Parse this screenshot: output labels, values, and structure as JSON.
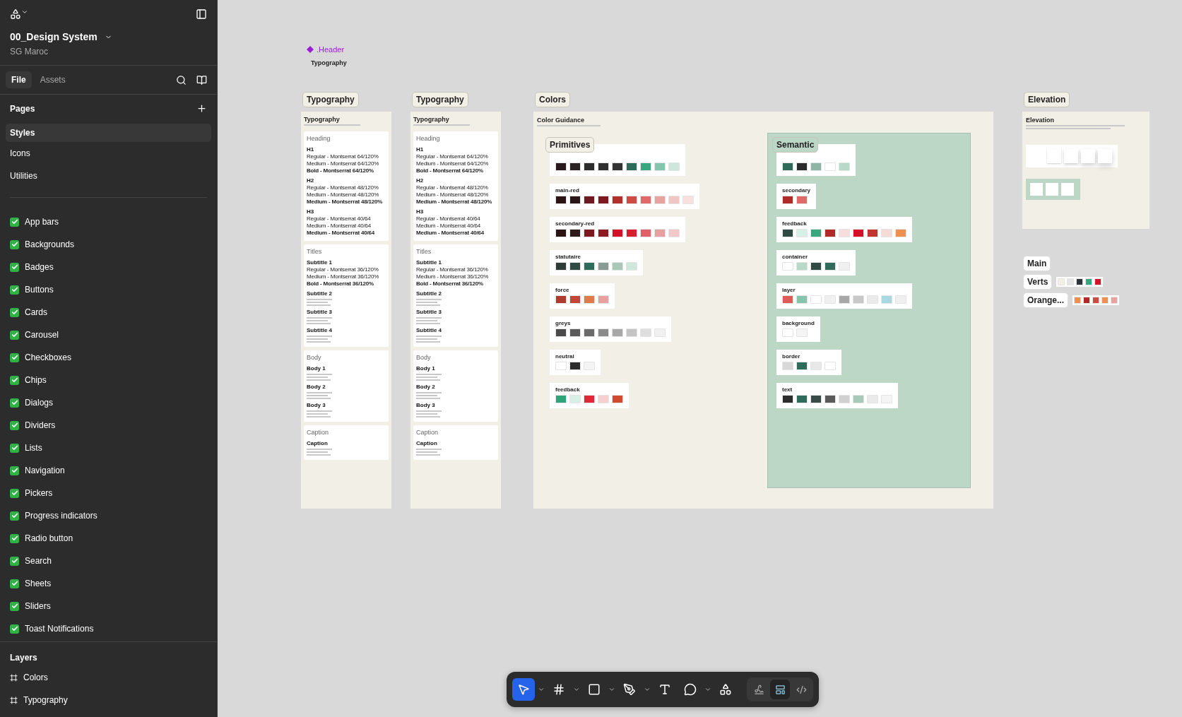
{
  "sidebar": {
    "file_title": "00_Design System",
    "team": "SG Maroc",
    "tabs": [
      {
        "label": "File",
        "selected": true
      },
      {
        "label": "Assets",
        "selected": false
      }
    ],
    "pages_heading": "Pages",
    "pages": [
      {
        "label": "Styles",
        "selected": true
      },
      {
        "label": "Icons",
        "selected": false
      },
      {
        "label": "Utilities",
        "selected": false
      }
    ],
    "components": [
      {
        "label": "App bars",
        "checked": true
      },
      {
        "label": "Backgrounds",
        "checked": true
      },
      {
        "label": "Badges",
        "checked": true
      },
      {
        "label": "Buttons",
        "checked": true
      },
      {
        "label": "Cards",
        "checked": true
      },
      {
        "label": "Carousel",
        "checked": true
      },
      {
        "label": "Checkboxes",
        "checked": true
      },
      {
        "label": "Chips",
        "checked": true
      },
      {
        "label": "Dialogs",
        "checked": true
      },
      {
        "label": "Dividers",
        "checked": true
      },
      {
        "label": "Lists",
        "checked": true
      },
      {
        "label": "Navigation",
        "checked": true
      },
      {
        "label": "Pickers",
        "checked": true
      },
      {
        "label": "Progress indicators",
        "checked": true
      },
      {
        "label": "Radio button",
        "checked": true
      },
      {
        "label": "Search",
        "checked": true
      },
      {
        "label": "Sheets",
        "checked": true
      },
      {
        "label": "Sliders",
        "checked": true
      },
      {
        "label": "Toast Notifications",
        "checked": true
      }
    ],
    "layers_heading": "Layers",
    "layers": [
      {
        "label": "Colors",
        "selected": false
      },
      {
        "label": "Typography",
        "selected": false
      }
    ]
  },
  "canvas": {
    "header_component": {
      "name": ".Header",
      "title": "Typography"
    },
    "typography_frames": [
      {
        "label": "Typography",
        "title": "Typography",
        "sections": [
          {
            "title": "Heading",
            "groups": [
              {
                "name": "H1",
                "lines": [
                  {
                    "text": "Regular - Montserrat 64/120%",
                    "kind": "regular"
                  },
                  {
                    "text": "Medium - Montserrat 64/120%",
                    "kind": "medium"
                  },
                  {
                    "text": "Bold - Montserrat 64/120%",
                    "kind": "bold"
                  }
                ]
              },
              {
                "name": "H2",
                "lines": [
                  {
                    "text": "Regular - Montserrat 48/120%",
                    "kind": "regular"
                  },
                  {
                    "text": "Medium - Montserrat 48/120%",
                    "kind": "medium"
                  },
                  {
                    "text": "Medium - Montserrat 48/120%",
                    "kind": "bold"
                  }
                ]
              },
              {
                "name": "H3",
                "lines": [
                  {
                    "text": "Regular - Montserrat 40/64",
                    "kind": "regular"
                  },
                  {
                    "text": "Medium - Montserrat 40/64",
                    "kind": "medium"
                  },
                  {
                    "text": "Medium - Montserrat 40/64",
                    "kind": "bold"
                  }
                ]
              }
            ]
          },
          {
            "title": "Titles",
            "groups": [
              {
                "name": "Subtitle 1",
                "lines": [
                  {
                    "text": "Regular - Montserrat 36/120%",
                    "kind": "regular"
                  },
                  {
                    "text": "Medium - Montserrat 36/120%",
                    "kind": "medium"
                  },
                  {
                    "text": "Bold - Montserrat 36/120%",
                    "kind": "bold"
                  }
                ]
              },
              {
                "name": "Subtitle 2"
              },
              {
                "name": "Subtitle 3"
              },
              {
                "name": "Subtitle 4"
              }
            ]
          },
          {
            "title": "Body",
            "groups": [
              {
                "name": "Body 1"
              },
              {
                "name": "Body 2"
              },
              {
                "name": "Body 3"
              }
            ]
          },
          {
            "title": "Caption",
            "groups": [
              {
                "name": "Caption"
              }
            ]
          }
        ]
      },
      {
        "label": "Typography",
        "title": "Typography",
        "sections": [
          {
            "title": "Heading",
            "groups": [
              {
                "name": "H1",
                "lines": [
                  {
                    "text": "Regular - Montserrat 64/120%",
                    "kind": "regular"
                  },
                  {
                    "text": "Medium - Montserrat 64/120%",
                    "kind": "medium"
                  },
                  {
                    "text": "Bold - Montserrat 64/120%",
                    "kind": "bold"
                  }
                ]
              },
              {
                "name": "H2",
                "lines": [
                  {
                    "text": "Regular - Montserrat 48/120%",
                    "kind": "regular"
                  },
                  {
                    "text": "Medium - Montserrat 48/120%",
                    "kind": "medium"
                  },
                  {
                    "text": "Medium - Montserrat 48/120%",
                    "kind": "bold"
                  }
                ]
              },
              {
                "name": "H3",
                "lines": [
                  {
                    "text": "Regular - Montserrat 40/64",
                    "kind": "regular"
                  },
                  {
                    "text": "Medium - Montserrat 40/64",
                    "kind": "medium"
                  },
                  {
                    "text": "Medium - Montserrat 40/64",
                    "kind": "bold"
                  }
                ]
              }
            ]
          },
          {
            "title": "Titles",
            "groups": [
              {
                "name": "Subtitle 1",
                "lines": [
                  {
                    "text": "Regular - Montserrat 36/120%",
                    "kind": "regular"
                  },
                  {
                    "text": "Medium - Montserrat 36/120%",
                    "kind": "medium"
                  },
                  {
                    "text": "Bold - Montserrat 36/120%",
                    "kind": "bold"
                  }
                ]
              },
              {
                "name": "Subtitle 2"
              },
              {
                "name": "Subtitle 3"
              },
              {
                "name": "Subtitle 4"
              }
            ]
          },
          {
            "title": "Body",
            "groups": [
              {
                "name": "Body 1"
              },
              {
                "name": "Body 2"
              },
              {
                "name": "Body 3"
              }
            ]
          },
          {
            "title": "Caption",
            "groups": [
              {
                "name": "Caption"
              }
            ]
          }
        ]
      }
    ],
    "colors_frame": {
      "label": "Colors",
      "title": "Color Guidance",
      "primitives": {
        "label": "Primitives",
        "palettes": [
          {
            "swatches": [
              {
                "color": "#2a1a1e"
              },
              {
                "color": "#2b2224"
              },
              {
                "color": "#2c2c2c"
              },
              {
                "color": "#2f2f2f"
              },
              {
                "color": "#333333"
              },
              {
                "color": "#2e6b5a"
              },
              {
                "color": "#3aa67f"
              },
              {
                "color": "#86c4ad"
              },
              {
                "color": "#cfe6dc"
              }
            ]
          },
          {
            "title": "main-red",
            "swatches": [
              {
                "color": "#2a1414"
              },
              {
                "color": "#2a1618"
              },
              {
                "color": "#6e1a22"
              },
              {
                "color": "#7c1a20"
              },
              {
                "color": "#b2302c"
              },
              {
                "color": "#d04a44"
              },
              {
                "color": "#e06a6a"
              },
              {
                "color": "#e7a3a0"
              },
              {
                "color": "#f0c6c4"
              },
              {
                "color": "#f7e0de"
              }
            ]
          },
          {
            "title": "secondary-red",
            "swatches": [
              {
                "color": "#2a1414"
              },
              {
                "color": "#2e1b1b"
              },
              {
                "color": "#7c1a20"
              },
              {
                "color": "#8a1c22"
              },
              {
                "color": "#d4102a"
              },
              {
                "color": "#d81f32"
              },
              {
                "color": "#e0606a"
              },
              {
                "color": "#e7a0a0"
              },
              {
                "color": "#f2c8c8"
              }
            ]
          },
          {
            "title": "statutaire",
            "swatches": [
              {
                "color": "#2f3b36"
              },
              {
                "color": "#2e4a42"
              },
              {
                "color": "#2e6b5a"
              },
              {
                "color": "#8a9a94"
              },
              {
                "color": "#a8c8b8"
              },
              {
                "color": "#cfe6dc"
              }
            ]
          },
          {
            "title": "force",
            "swatches": [
              {
                "color": "#b03a2e"
              },
              {
                "color": "#c0463a"
              },
              {
                "color": "#e07a4a"
              },
              {
                "color": "#e8a0a0"
              }
            ]
          },
          {
            "title": "greys",
            "swatches": [
              {
                "color": "#4a4a4a"
              },
              {
                "color": "#5a5a5a"
              },
              {
                "color": "#6a6a6a"
              },
              {
                "color": "#8a8a8a"
              },
              {
                "color": "#a8a8a8"
              },
              {
                "color": "#c4c4c4"
              },
              {
                "color": "#dedede"
              },
              {
                "color": "#f0f0f0"
              }
            ]
          },
          {
            "title": "neutral",
            "swatches": [
              {
                "color": "#ffffff"
              },
              {
                "color": "#2c2c2c"
              },
              {
                "color": "#f4f4f4"
              }
            ]
          },
          {
            "title": "feedback",
            "swatches": [
              {
                "color": "#2fa37a"
              },
              {
                "color": "#d7efe4"
              },
              {
                "color": "#e0283a"
              },
              {
                "color": "#f6d0d0"
              },
              {
                "color": "#d04a2e"
              }
            ]
          }
        ]
      },
      "semantic": {
        "label": "Semantic",
        "palettes": [
          {
            "swatches": [
              {
                "color": "#2e6b5a"
              },
              {
                "color": "#2c2c2c"
              },
              {
                "color": "#8fb5a5"
              },
              {
                "color": "#ffffff"
              },
              {
                "color": "#b8d8c8"
              }
            ]
          },
          {
            "title": "secondary",
            "swatches": [
              {
                "color": "#b02a2a"
              },
              {
                "color": "#e06a6a"
              }
            ]
          },
          {
            "title": "feedback",
            "swatches": [
              {
                "color": "#2e4a42"
              },
              {
                "color": "#d7efe4"
              },
              {
                "color": "#3aa67f"
              },
              {
                "color": "#b02a2a"
              },
              {
                "color": "#f6dede"
              },
              {
                "color": "#d4102a"
              },
              {
                "color": "#c0362e"
              },
              {
                "color": "#f6dcd6"
              },
              {
                "color": "#ef9050"
              }
            ]
          },
          {
            "title": "container",
            "swatches": [
              {
                "color": "#ffffff"
              },
              {
                "color": "#b8d8c8"
              },
              {
                "color": "#2e4a42"
              },
              {
                "color": "#2e6b5a"
              },
              {
                "color": "#f0f0f0"
              }
            ]
          },
          {
            "title": "layer",
            "swatches": [
              {
                "color": "#e05a5a"
              },
              {
                "color": "#86c4ad"
              },
              {
                "color": "#ffffff"
              },
              {
                "color": "#f0f0f0"
              },
              {
                "color": "#a8a8a8"
              },
              {
                "color": "#c8c8c8"
              },
              {
                "color": "#eaeaea"
              },
              {
                "color": "#a8d8e0"
              },
              {
                "color": "#f0f0f0"
              }
            ]
          },
          {
            "title": "background",
            "swatches": [
              {
                "color": "#ffffff"
              },
              {
                "color": "#f4f4f4"
              }
            ]
          },
          {
            "title": "border",
            "swatches": [
              {
                "color": "#d8d8d8"
              },
              {
                "color": "#2e6b5a"
              },
              {
                "color": "#e8e8e8"
              },
              {
                "color": "#ffffff"
              }
            ]
          },
          {
            "title": "text",
            "swatches": [
              {
                "color": "#2c2c2c"
              },
              {
                "color": "#2e6b5a"
              },
              {
                "color": "#3a4a46"
              },
              {
                "color": "#5a5a5a"
              },
              {
                "color": "#d0d0d0"
              },
              {
                "color": "#a8c8b8"
              },
              {
                "color": "#eaeaea"
              },
              {
                "color": "#f4f4f4"
              }
            ]
          }
        ]
      }
    },
    "elevation_frame": {
      "label": "Elevation",
      "title": "Elevation"
    },
    "color_groups": [
      {
        "label": "Main"
      },
      {
        "label": "Verts",
        "swatches": [
          {
            "color": "#f2efe6"
          },
          {
            "color": "#e4e4e4"
          },
          {
            "color": "#2c3338"
          },
          {
            "color": "#3aa67f"
          },
          {
            "color": "#d4102a"
          }
        ]
      },
      {
        "label": "Orange...",
        "swatches": [
          {
            "color": "#ef9050"
          },
          {
            "color": "#b02a2a"
          },
          {
            "color": "#d04a44"
          },
          {
            "color": "#ef9050"
          },
          {
            "color": "#e7a3a0"
          }
        ]
      }
    ]
  },
  "toolbar": {
    "tools": [
      {
        "kind": "move",
        "selected": true
      },
      {
        "kind": "caret",
        "selected": false
      },
      {
        "kind": "frame",
        "selected": false
      },
      {
        "kind": "caret",
        "selected": false
      },
      {
        "kind": "rectangle",
        "selected": false
      },
      {
        "kind": "caret",
        "selected": false
      },
      {
        "kind": "pen",
        "selected": false
      },
      {
        "kind": "caret",
        "selected": false
      },
      {
        "kind": "text",
        "selected": false
      },
      {
        "kind": "comment",
        "selected": false
      },
      {
        "kind": "caret",
        "selected": false
      },
      {
        "kind": "actions",
        "selected": false
      }
    ],
    "modes": [
      {
        "kind": "draw",
        "selected": false
      },
      {
        "kind": "design",
        "selected": true
      },
      {
        "kind": "dev",
        "selected": false
      }
    ]
  }
}
